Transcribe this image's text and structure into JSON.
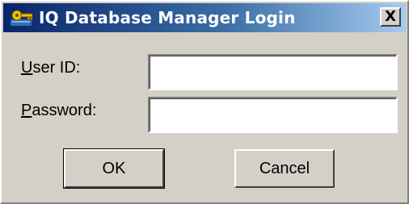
{
  "window": {
    "title": "IQ Database Manager Login",
    "close_symbol": "X",
    "icon": "key-icon"
  },
  "form": {
    "user_id": {
      "label_accel": "U",
      "label_rest": "ser ID:",
      "value": ""
    },
    "password": {
      "label_accel": "P",
      "label_rest": "assword:",
      "value": ""
    }
  },
  "buttons": {
    "ok_label": "OK",
    "cancel_label": "Cancel"
  },
  "colors": {
    "titlebar_start": "#0a246a",
    "titlebar_end": "#a6caf0",
    "face": "#d4d0c8"
  }
}
